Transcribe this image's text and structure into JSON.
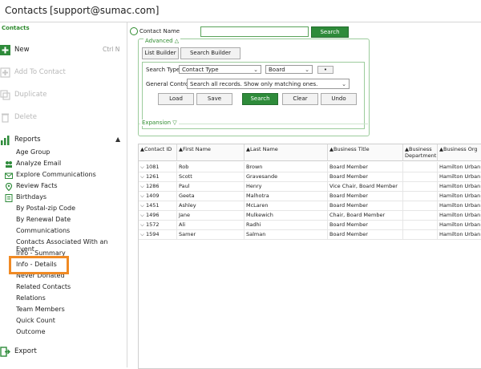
{
  "window": {
    "title": "Contacts",
    "user": "[support@sumac.com]"
  },
  "sidebar": {
    "heading": "Contacts",
    "actions": [
      {
        "label": "New",
        "shortcut": "Ctrl N",
        "icon": "plus-icon",
        "disabled": false
      },
      {
        "label": "Add To Contact",
        "icon": "add-contact-icon",
        "disabled": true
      },
      {
        "label": "Duplicate",
        "icon": "duplicate-icon",
        "disabled": true
      },
      {
        "label": "Delete",
        "icon": "delete-icon",
        "disabled": true
      }
    ],
    "reports": {
      "label": "Reports",
      "icon": "bar-chart-icon",
      "items": [
        "Age Group",
        "Analyze Email",
        "Explore Communications",
        "Review Facts",
        "Birthdays",
        "By Postal-zip Code",
        "By Renewal Date",
        "Communications",
        "Contacts Associated With an Event",
        "Info - Summary",
        "Info - Details",
        "Never Donated",
        "Related Contacts",
        "Relations",
        "Team Members",
        "Quick Count",
        "Outcome"
      ]
    },
    "export_label": "Export",
    "highlighted_item": "Info - Details"
  },
  "search": {
    "contact_name_label": "Contact Name",
    "contact_name_value": "",
    "search_button": "Search",
    "advanced_label": "Advanced △",
    "list_builder": "List Builder",
    "search_builder": "Search Builder",
    "search_type_label": "Search Type:",
    "search_type_value": "Contact Type",
    "search_type_value2": "Board",
    "general_control_label": "General Control:",
    "general_control_value": "Search all records. Show only matching ones.",
    "buttons": [
      "Load",
      "Save",
      "Search",
      "Clear",
      "Undo"
    ],
    "expansion_label": "Expansion ▽"
  },
  "grid": {
    "columns": [
      "Contact ID",
      "First Name",
      "Last Name",
      "Business Title",
      "Business Department",
      "Business Org"
    ],
    "rows": [
      [
        "1081",
        "Rob",
        "Brown",
        "Board Member",
        "",
        "Hamilton Urban"
      ],
      [
        "1261",
        "Scott",
        "Gravesande",
        "Board Member",
        "",
        "Hamilton Urban"
      ],
      [
        "1286",
        "Paul",
        "Henry",
        "Vice Chair, Board Member",
        "",
        "Hamilton Urban"
      ],
      [
        "1409",
        "Geeta",
        "Malhotra",
        "Board Member",
        "",
        "Hamilton Urban"
      ],
      [
        "1451",
        "Ashley",
        "McLaren",
        "Board Member",
        "",
        "Hamilton Urban"
      ],
      [
        "1496",
        "Jane",
        "Mulkewich",
        "Chair, Board Member",
        "",
        "Hamilton Urban"
      ],
      [
        "1572",
        "Ali",
        "Radhi",
        "Board Member",
        "",
        "Hamilton Urban"
      ],
      [
        "1594",
        "Samer",
        "Salman",
        "Board Member",
        "",
        "Hamilton Urban"
      ]
    ]
  },
  "colors": {
    "accent": "#2e8b3a",
    "highlight": "#f08a24"
  }
}
